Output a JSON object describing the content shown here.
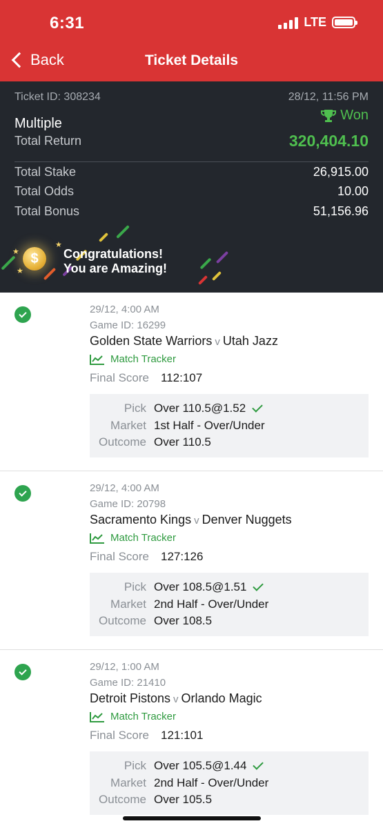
{
  "status_bar": {
    "time": "6:31",
    "network": "LTE"
  },
  "nav": {
    "back_label": "Back",
    "title": "Ticket Details"
  },
  "ticket": {
    "id_text": "Ticket ID: 308234",
    "datetime": "28/12, 11:56 PM",
    "status": "Won",
    "type": "Multiple",
    "total_return_label": "Total Return",
    "total_return": "320,404.10",
    "rows": [
      {
        "label": "Total Stake",
        "value": "26,915.00"
      },
      {
        "label": "Total Odds",
        "value": "10.00"
      },
      {
        "label": "Total Bonus",
        "value": "51,156.96"
      }
    ],
    "congrats_line1": "Congratulations!",
    "congrats_line2": "You are Amazing!"
  },
  "legs": [
    {
      "datetime": "29/12, 4:00 AM",
      "game_id": "Game ID: 16299",
      "home": "Golden State Warriors",
      "vs": "v",
      "away": "Utah Jazz",
      "tracker": "Match Tracker",
      "final_score_label": "Final Score",
      "final_score": "112:107",
      "pick_label": "Pick",
      "pick": "Over 110.5@1.52",
      "market_label": "Market",
      "market": "1st Half - Over/Under",
      "outcome_label": "Outcome",
      "outcome": "Over 110.5"
    },
    {
      "datetime": "29/12, 4:00 AM",
      "game_id": "Game ID: 20798",
      "home": "Sacramento Kings",
      "vs": "v",
      "away": "Denver Nuggets",
      "tracker": "Match Tracker",
      "final_score_label": "Final Score",
      "final_score": "127:126",
      "pick_label": "Pick",
      "pick": "Over 108.5@1.51",
      "market_label": "Market",
      "market": "2nd Half - Over/Under",
      "outcome_label": "Outcome",
      "outcome": "Over 108.5"
    },
    {
      "datetime": "29/12, 1:00 AM",
      "game_id": "Game ID: 21410",
      "home": "Detroit Pistons",
      "vs": "v",
      "away": "Orlando Magic",
      "tracker": "Match Tracker",
      "final_score_label": "Final Score",
      "final_score": "121:101",
      "pick_label": "Pick",
      "pick": "Over 105.5@1.44",
      "market_label": "Market",
      "market": "2nd Half - Over/Under",
      "outcome_label": "Outcome",
      "outcome": "Over 105.5"
    }
  ],
  "colors": {
    "header_red": "#d93434",
    "summary_dark": "#23272d",
    "win_green": "#4fbf4f",
    "check_green": "#2ea44f"
  }
}
